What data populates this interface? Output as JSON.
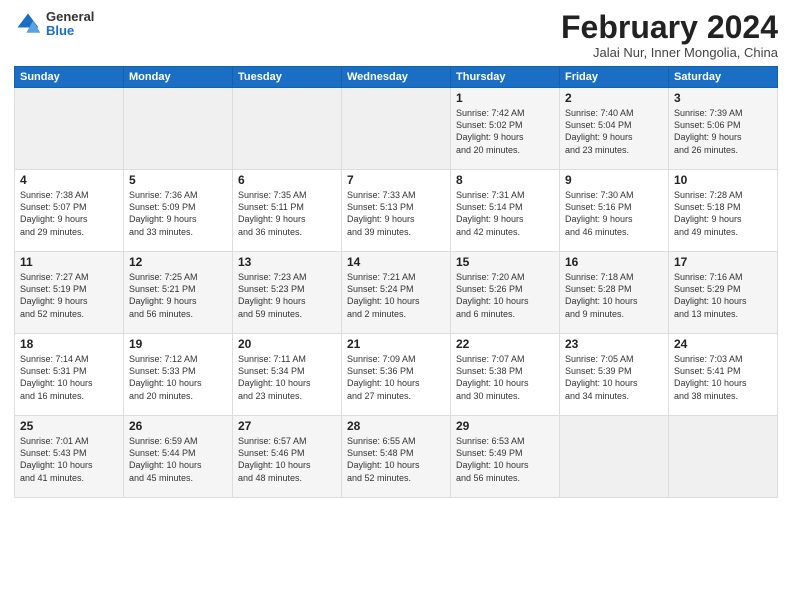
{
  "logo": {
    "general": "General",
    "blue": "Blue"
  },
  "title": "February 2024",
  "subtitle": "Jalai Nur, Inner Mongolia, China",
  "weekdays": [
    "Sunday",
    "Monday",
    "Tuesday",
    "Wednesday",
    "Thursday",
    "Friday",
    "Saturday"
  ],
  "weeks": [
    [
      {
        "day": "",
        "info": ""
      },
      {
        "day": "",
        "info": ""
      },
      {
        "day": "",
        "info": ""
      },
      {
        "day": "",
        "info": ""
      },
      {
        "day": "1",
        "info": "Sunrise: 7:42 AM\nSunset: 5:02 PM\nDaylight: 9 hours\nand 20 minutes."
      },
      {
        "day": "2",
        "info": "Sunrise: 7:40 AM\nSunset: 5:04 PM\nDaylight: 9 hours\nand 23 minutes."
      },
      {
        "day": "3",
        "info": "Sunrise: 7:39 AM\nSunset: 5:06 PM\nDaylight: 9 hours\nand 26 minutes."
      }
    ],
    [
      {
        "day": "4",
        "info": "Sunrise: 7:38 AM\nSunset: 5:07 PM\nDaylight: 9 hours\nand 29 minutes."
      },
      {
        "day": "5",
        "info": "Sunrise: 7:36 AM\nSunset: 5:09 PM\nDaylight: 9 hours\nand 33 minutes."
      },
      {
        "day": "6",
        "info": "Sunrise: 7:35 AM\nSunset: 5:11 PM\nDaylight: 9 hours\nand 36 minutes."
      },
      {
        "day": "7",
        "info": "Sunrise: 7:33 AM\nSunset: 5:13 PM\nDaylight: 9 hours\nand 39 minutes."
      },
      {
        "day": "8",
        "info": "Sunrise: 7:31 AM\nSunset: 5:14 PM\nDaylight: 9 hours\nand 42 minutes."
      },
      {
        "day": "9",
        "info": "Sunrise: 7:30 AM\nSunset: 5:16 PM\nDaylight: 9 hours\nand 46 minutes."
      },
      {
        "day": "10",
        "info": "Sunrise: 7:28 AM\nSunset: 5:18 PM\nDaylight: 9 hours\nand 49 minutes."
      }
    ],
    [
      {
        "day": "11",
        "info": "Sunrise: 7:27 AM\nSunset: 5:19 PM\nDaylight: 9 hours\nand 52 minutes."
      },
      {
        "day": "12",
        "info": "Sunrise: 7:25 AM\nSunset: 5:21 PM\nDaylight: 9 hours\nand 56 minutes."
      },
      {
        "day": "13",
        "info": "Sunrise: 7:23 AM\nSunset: 5:23 PM\nDaylight: 9 hours\nand 59 minutes."
      },
      {
        "day": "14",
        "info": "Sunrise: 7:21 AM\nSunset: 5:24 PM\nDaylight: 10 hours\nand 2 minutes."
      },
      {
        "day": "15",
        "info": "Sunrise: 7:20 AM\nSunset: 5:26 PM\nDaylight: 10 hours\nand 6 minutes."
      },
      {
        "day": "16",
        "info": "Sunrise: 7:18 AM\nSunset: 5:28 PM\nDaylight: 10 hours\nand 9 minutes."
      },
      {
        "day": "17",
        "info": "Sunrise: 7:16 AM\nSunset: 5:29 PM\nDaylight: 10 hours\nand 13 minutes."
      }
    ],
    [
      {
        "day": "18",
        "info": "Sunrise: 7:14 AM\nSunset: 5:31 PM\nDaylight: 10 hours\nand 16 minutes."
      },
      {
        "day": "19",
        "info": "Sunrise: 7:12 AM\nSunset: 5:33 PM\nDaylight: 10 hours\nand 20 minutes."
      },
      {
        "day": "20",
        "info": "Sunrise: 7:11 AM\nSunset: 5:34 PM\nDaylight: 10 hours\nand 23 minutes."
      },
      {
        "day": "21",
        "info": "Sunrise: 7:09 AM\nSunset: 5:36 PM\nDaylight: 10 hours\nand 27 minutes."
      },
      {
        "day": "22",
        "info": "Sunrise: 7:07 AM\nSunset: 5:38 PM\nDaylight: 10 hours\nand 30 minutes."
      },
      {
        "day": "23",
        "info": "Sunrise: 7:05 AM\nSunset: 5:39 PM\nDaylight: 10 hours\nand 34 minutes."
      },
      {
        "day": "24",
        "info": "Sunrise: 7:03 AM\nSunset: 5:41 PM\nDaylight: 10 hours\nand 38 minutes."
      }
    ],
    [
      {
        "day": "25",
        "info": "Sunrise: 7:01 AM\nSunset: 5:43 PM\nDaylight: 10 hours\nand 41 minutes."
      },
      {
        "day": "26",
        "info": "Sunrise: 6:59 AM\nSunset: 5:44 PM\nDaylight: 10 hours\nand 45 minutes."
      },
      {
        "day": "27",
        "info": "Sunrise: 6:57 AM\nSunset: 5:46 PM\nDaylight: 10 hours\nand 48 minutes."
      },
      {
        "day": "28",
        "info": "Sunrise: 6:55 AM\nSunset: 5:48 PM\nDaylight: 10 hours\nand 52 minutes."
      },
      {
        "day": "29",
        "info": "Sunrise: 6:53 AM\nSunset: 5:49 PM\nDaylight: 10 hours\nand 56 minutes."
      },
      {
        "day": "",
        "info": ""
      },
      {
        "day": "",
        "info": ""
      }
    ]
  ]
}
